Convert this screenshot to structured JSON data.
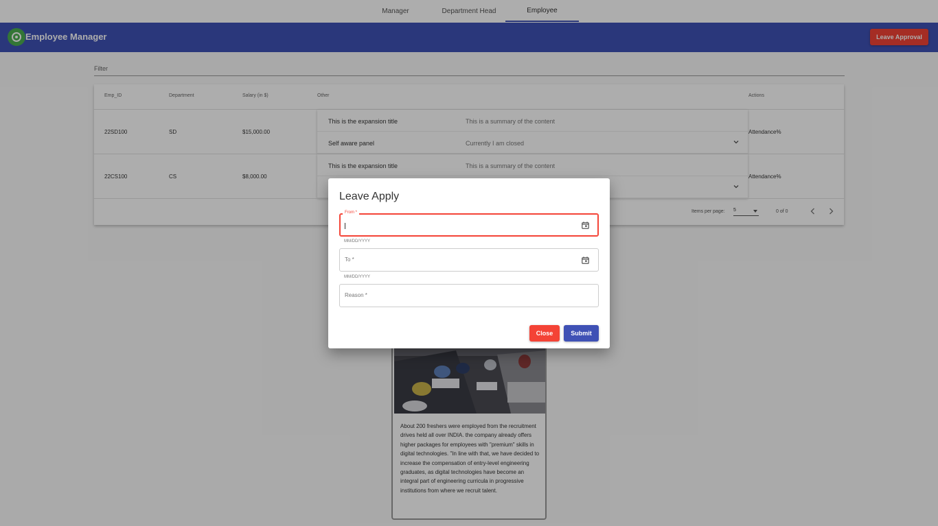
{
  "top_tabs": [
    {
      "label": "Manager"
    },
    {
      "label": "Department Head"
    },
    {
      "label": "Employee"
    }
  ],
  "header": {
    "title": "Employee Manager",
    "leave_approval_label": "Leave Approval"
  },
  "filter": {
    "label": "Filter"
  },
  "table": {
    "columns": [
      "Emp_ID",
      "Department",
      "Salary (in $)",
      "Other",
      "Actions"
    ],
    "rows": [
      {
        "emp_id": "22SD100",
        "department": "SD",
        "salary": "$15,000.00",
        "panel_title": "This is the expansion title",
        "panel_summary": "This is a summary of the content",
        "self_aware_title": "Self aware panel",
        "self_aware_state": "Currently I am closed",
        "action": "Attendance%"
      },
      {
        "emp_id": "22CS100",
        "department": "CS",
        "salary": "$8,000.00",
        "panel_title": "This is the expansion title",
        "panel_summary": "This is a summary of the content",
        "action": "Attendance%"
      }
    ],
    "paginator": {
      "items_per_page_label": "Items per page:",
      "items_per_page_value": "5",
      "range_label": "0 of 0"
    }
  },
  "article": {
    "text": "About 200 freshers were employed from the recruitment drives held all over INDIA. the company already offers higher packages for employees with \"premium\" skills in digital technologies. \"In line with that, we have decided to increase the compensation of entry-level engineering graduates, as digital technologies have become an integral part of engineering curricula in progressive institutions from where we recruit talent."
  },
  "dialog": {
    "title": "Leave Apply",
    "from_label": "From *",
    "from_hint": "MM/DD/YYYY",
    "to_label": "To *",
    "to_hint": "MM/DD/YYYY",
    "reason_label": "Reason *",
    "close_label": "Close",
    "submit_label": "Submit"
  },
  "colors": {
    "primary": "#3f51b5",
    "warn": "#f44336",
    "logo": "#4caf50"
  }
}
